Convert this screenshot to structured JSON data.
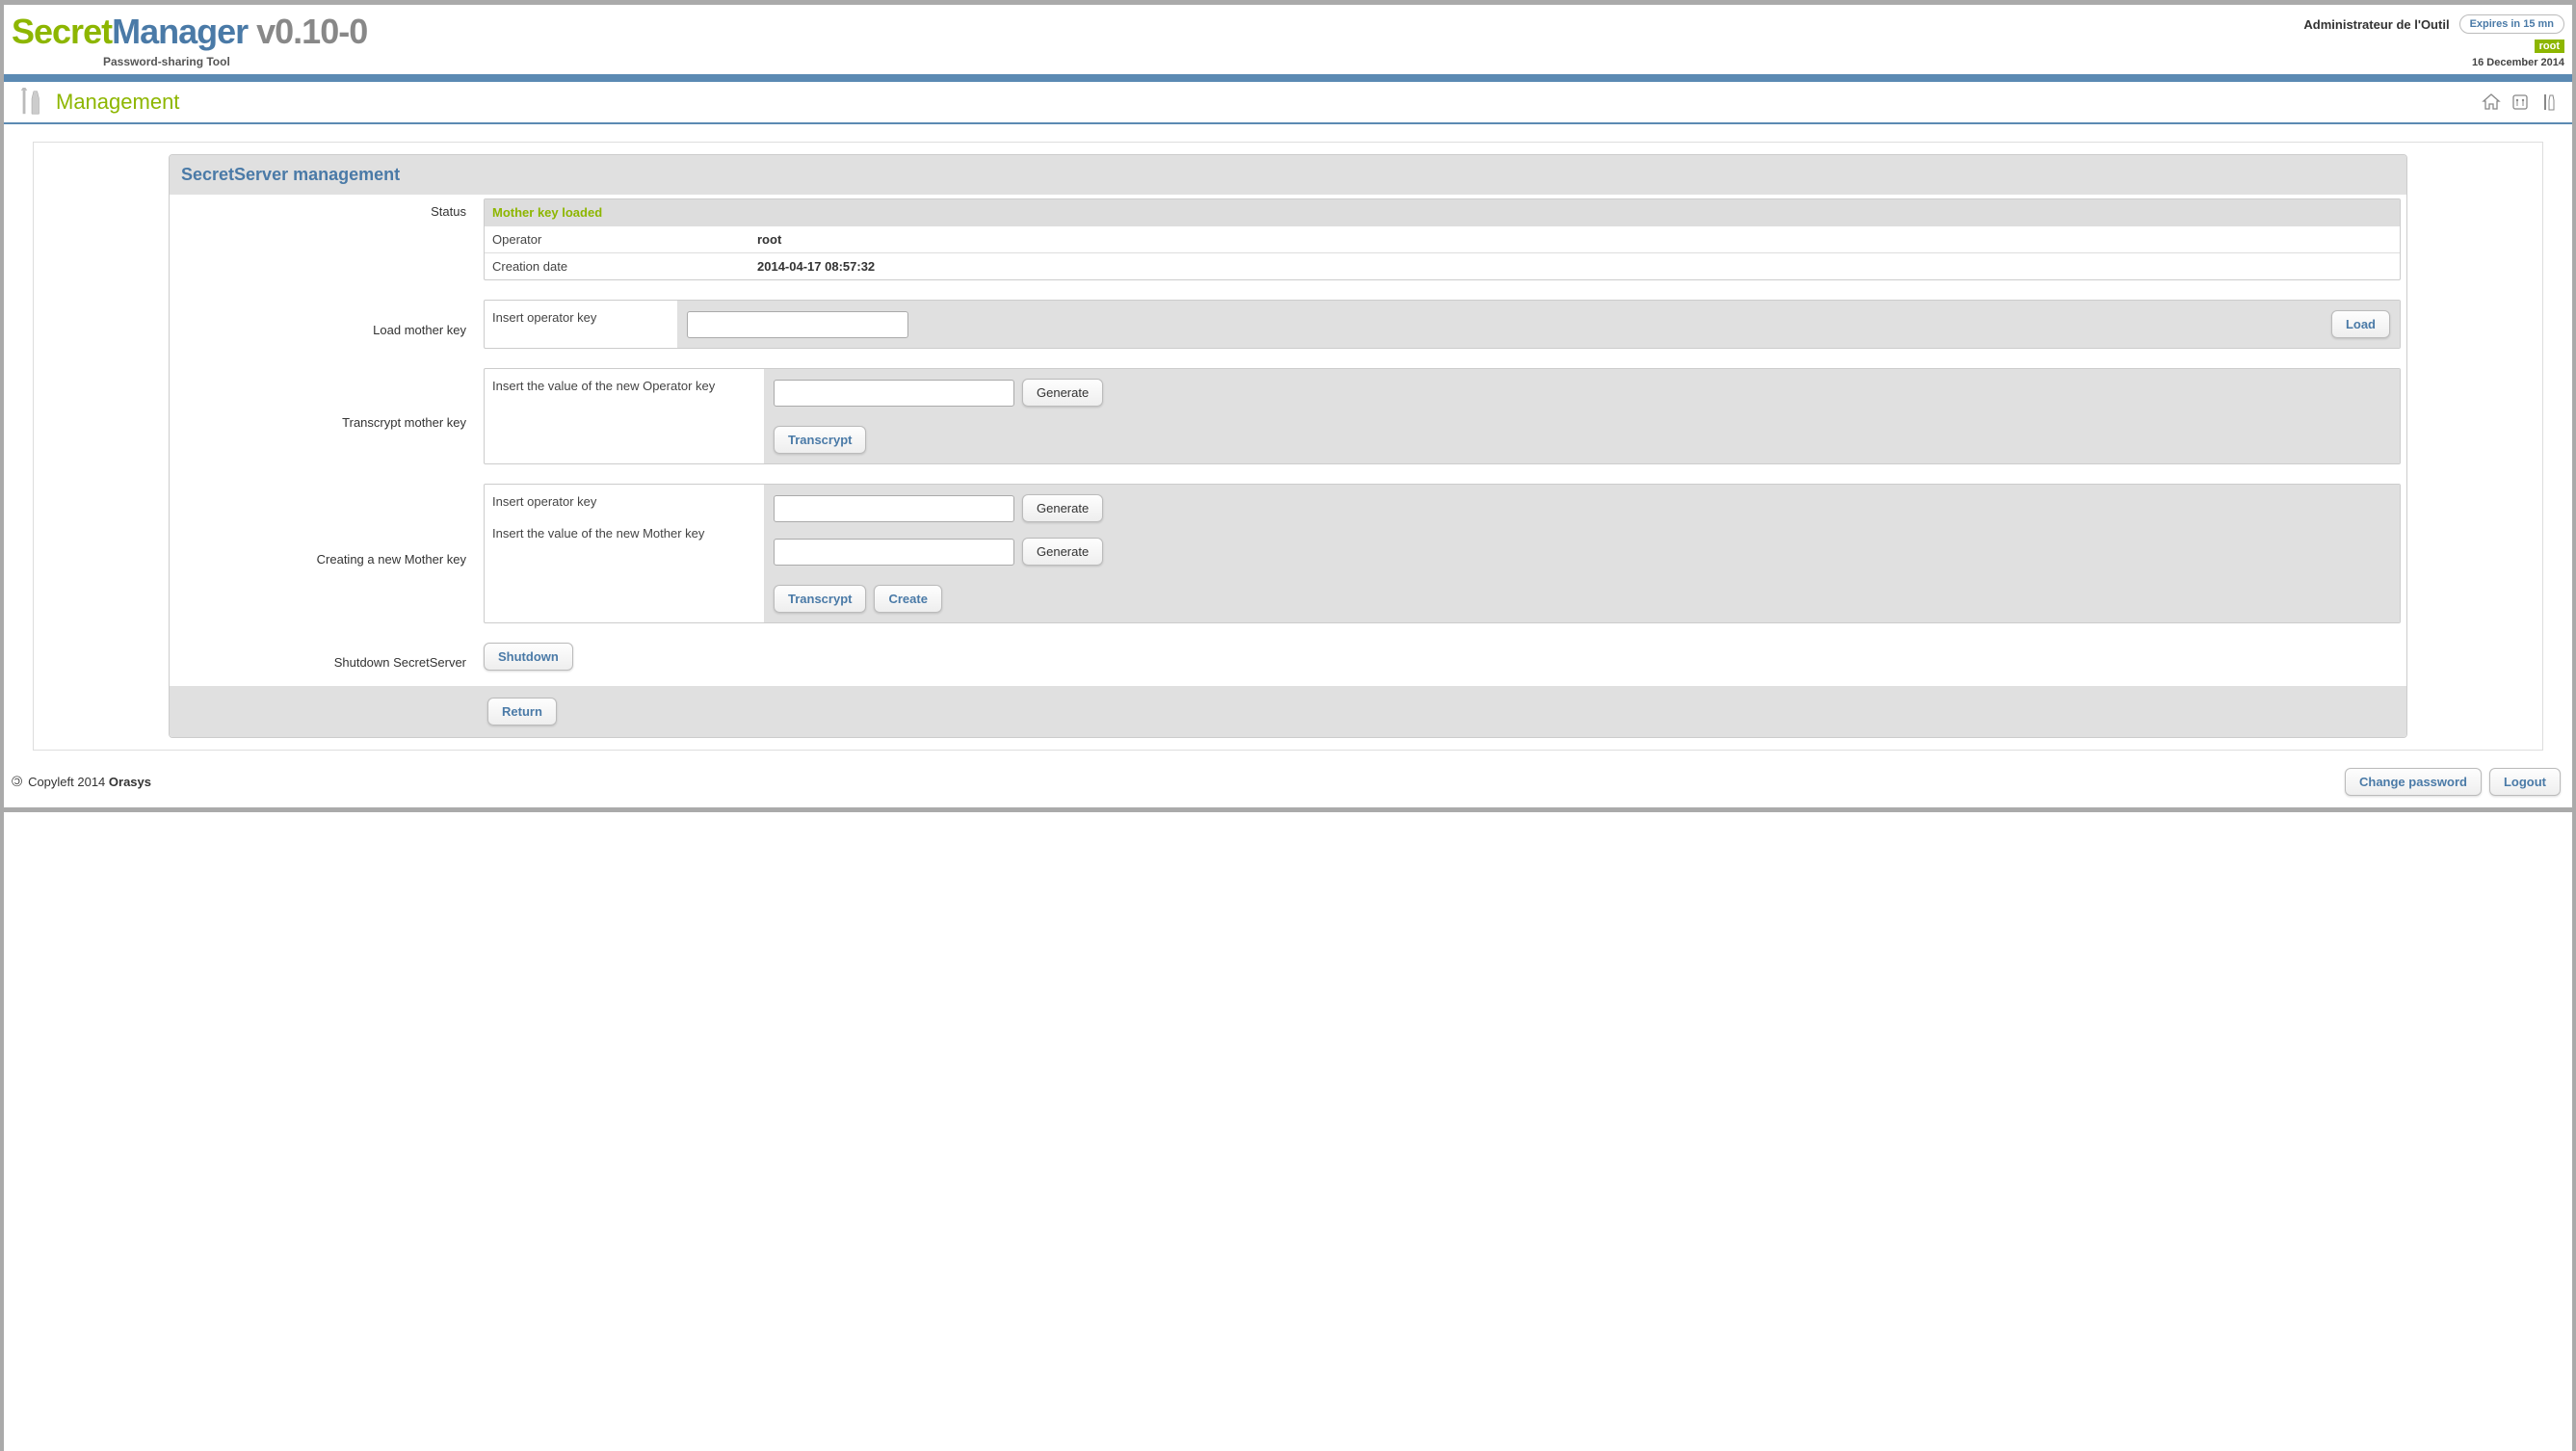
{
  "header": {
    "logo_secret": "Secret",
    "logo_manager": "Manager",
    "version": " v0.10-0",
    "tagline": "Password-sharing Tool",
    "admin_label": "Administrateur de l'Outil",
    "expires_label": "Expires in 15 mn",
    "root_badge": "root",
    "date": "16 December 2014"
  },
  "section": {
    "title": "Management"
  },
  "panel": {
    "title": "SecretServer management",
    "labels": {
      "status": "Status",
      "load_mother_key": "Load mother key",
      "transcrypt_mother_key": "Transcrypt mother key",
      "create_mother_key": "Creating a new Mother key",
      "shutdown": "Shutdown SecretServer"
    },
    "status": {
      "header": "Mother key loaded",
      "operator_label": "Operator",
      "operator_value": "root",
      "creation_label": "Creation date",
      "creation_value": "2014-04-17 08:57:32"
    },
    "load": {
      "prompt": "Insert operator key",
      "button": "Load"
    },
    "transcrypt": {
      "prompt": "Insert the value of the new Operator key",
      "generate_button": "Generate",
      "transcrypt_button": "Transcrypt"
    },
    "create": {
      "prompt_operator": "Insert operator key",
      "prompt_mother": "Insert the value of the new Mother key",
      "generate_button": "Generate",
      "transcrypt_button": "Transcrypt",
      "create_button": "Create"
    },
    "shutdown_button": "Shutdown",
    "return_button": "Return"
  },
  "footer": {
    "copyleft_prefix": "Copyleft 2014 ",
    "company": "Orasys",
    "change_password": "Change password",
    "logout": "Logout"
  }
}
